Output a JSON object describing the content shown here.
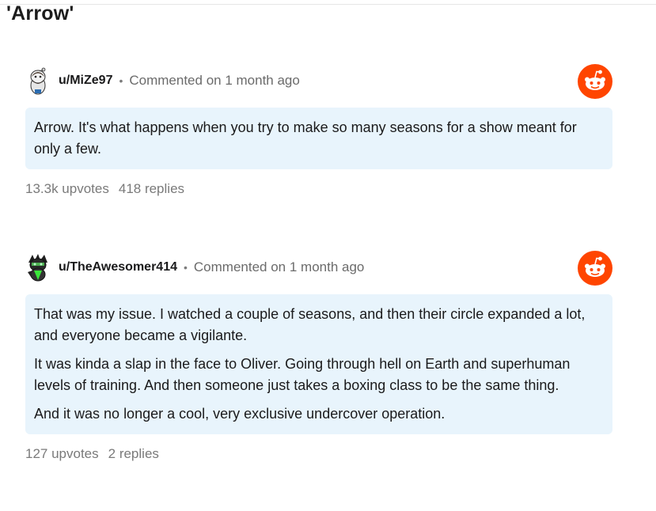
{
  "page": {
    "heading": "'Arrow'"
  },
  "comments": [
    {
      "username": "u/MiZe97",
      "separator": "•",
      "timestamp": "Commented on 1 month ago",
      "avatar_icon": "reddit-snoo-avatar-beard",
      "brand_icon": "reddit-logo-icon",
      "body": [
        "Arrow. It's what happens when you try to make so many seasons for a show meant for only a few."
      ],
      "upvotes": "13.3k upvotes",
      "replies": "418 replies"
    },
    {
      "username": "u/TheAwesomer414",
      "separator": "•",
      "timestamp": "Commented on 1 month ago",
      "avatar_icon": "reddit-snoo-avatar-green",
      "brand_icon": "reddit-logo-icon",
      "body": [
        "That was my issue. I watched a couple of seasons, and then their circle expanded a lot, and everyone became a vigilante.",
        "It was kinda a slap in the face to Oliver. Going through hell on Earth and superhuman levels of training. And then someone just takes a boxing class to be the same thing.",
        "And it was no longer a cool, very exclusive undercover operation."
      ],
      "upvotes": "127 upvotes",
      "replies": "2 replies"
    }
  ],
  "colors": {
    "reddit_orange": "#ff4500",
    "bubble_bg": "#e8f4fc",
    "muted_text": "#6b6b6b"
  }
}
